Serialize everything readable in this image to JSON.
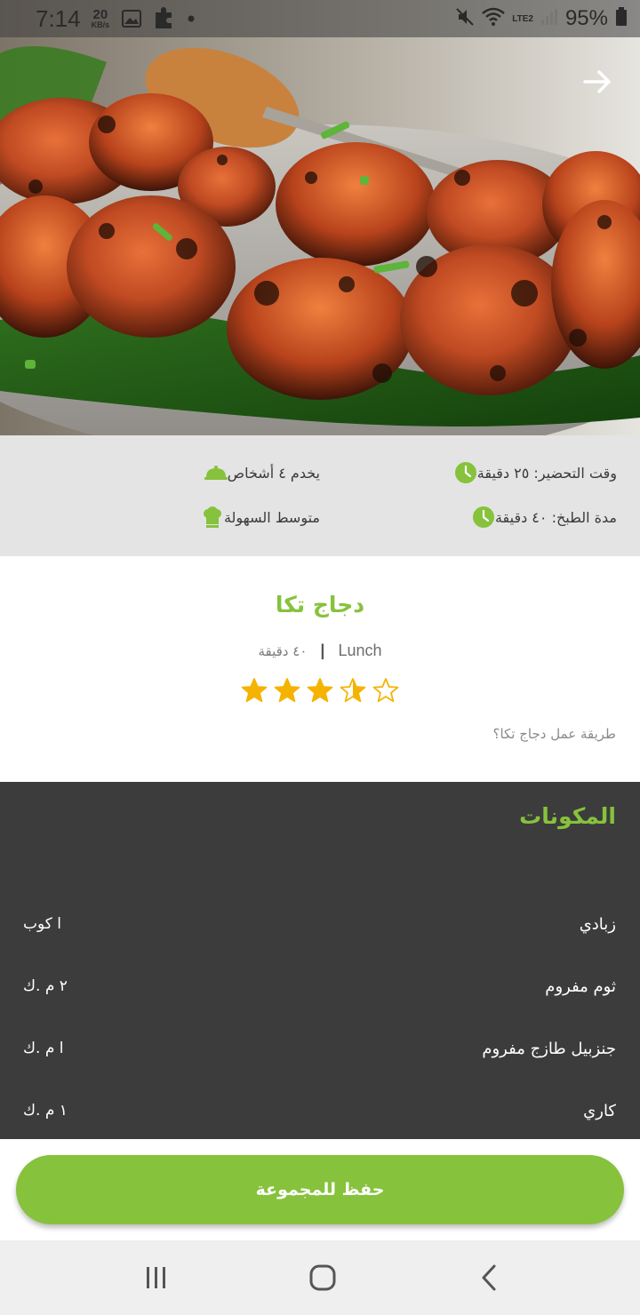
{
  "status_bar": {
    "time": "7:14",
    "net_speed_value": "20",
    "net_speed_unit": "KB/s",
    "network_label": "LTE2",
    "battery": "95%",
    "icons": [
      "gallery-icon",
      "puzzle-icon",
      "dot-icon",
      "mute-icon",
      "wifi-icon",
      "signal-icon",
      "battery-icon"
    ]
  },
  "hero": {
    "back_icon": "arrow-right-icon"
  },
  "info": {
    "prep_time": "وقت التحضير: ٢٥ دقيقة",
    "cook_time": "مدة الطبخ: ٤٠ دقيقة",
    "serves": "يخدم ٤ أشخاص",
    "difficulty": "متوسط السهولة",
    "accent_color": "#86c23c"
  },
  "recipe": {
    "title": "دجاج تكا",
    "duration": "٤٠ دقيقة",
    "separator": "|",
    "category": "Lunch",
    "rating": 3.5,
    "rating_max": 5,
    "question": "طريقة عمل دجاج تكا؟",
    "star_color": "#f5b301"
  },
  "ingredients": {
    "heading": "المكونات",
    "items": [
      {
        "name": "زبادي",
        "qty": "ا كوب"
      },
      {
        "name": "ثوم مفروم",
        "qty": "٢ م .ك"
      },
      {
        "name": "جنزبيل طازج مفروم",
        "qty": "ا م .ك"
      },
      {
        "name": "كاري",
        "qty": "١ م .ك"
      }
    ]
  },
  "save_button": {
    "label": "حفظ للمجموعة"
  },
  "navbar": {
    "icons": [
      "recents-icon",
      "home-icon",
      "back-icon"
    ]
  }
}
